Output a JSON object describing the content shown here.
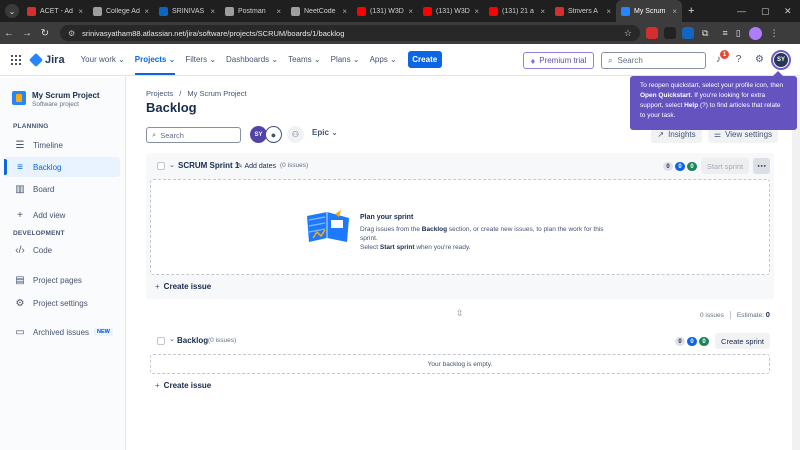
{
  "browser": {
    "tabs": [
      {
        "label": "ACET - Ad",
        "fav": "#d32f2f"
      },
      {
        "label": "College Ad",
        "fav": "#9e9e9e"
      },
      {
        "label": "SRINIVAS",
        "fav": "#0a66c2"
      },
      {
        "label": "Postman",
        "fav": "#9e9e9e"
      },
      {
        "label": "NeetCode",
        "fav": "#9e9e9e"
      },
      {
        "label": "(131) W3D",
        "fav": "#ff0000"
      },
      {
        "label": "(131) W3D",
        "fav": "#ff0000"
      },
      {
        "label": "(131) 21 a",
        "fav": "#ff0000"
      },
      {
        "label": "Strivers A",
        "fav": "#d32f2f"
      },
      {
        "label": "My Scrum",
        "fav": "#2684ff"
      }
    ],
    "url": "srinivasyatham88.atlassian.net/jira/software/projects/SCRUM/boards/1/backlog"
  },
  "topnav": {
    "product": "Jira",
    "menu": [
      "Your work",
      "Projects",
      "Filters",
      "Dashboards",
      "Teams",
      "Plans",
      "Apps"
    ],
    "create": "Create",
    "premium": "Premium trial",
    "search_placeholder": "Search",
    "notif_count": "1",
    "avatar_initials": "SY"
  },
  "sidebar": {
    "project_name": "My Scrum Project",
    "project_type": "Software project",
    "planning_header": "PLANNING",
    "timeline": "Timeline",
    "backlog": "Backlog",
    "board": "Board",
    "add_view": "Add view",
    "development_header": "DEVELOPMENT",
    "code": "Code",
    "project_pages": "Project pages",
    "project_settings": "Project settings",
    "archived_issues": "Archived issues",
    "new_badge": "NEW"
  },
  "main": {
    "breadcrumb_projects": "Projects",
    "breadcrumb_sep": "/",
    "breadcrumb_project": "My Scrum Project",
    "title": "Backlog",
    "search_placeholder": "Search",
    "avatar_initials": "SY",
    "epic": "Epic",
    "insights": "Insights",
    "view_settings": "View settings",
    "sprint": {
      "name": "SCRUM Sprint 1",
      "add_dates": "Add dates",
      "issue_count": "(0 issues)",
      "counts": [
        "0",
        "0",
        "0"
      ],
      "start": "Start sprint",
      "plan_heading": "Plan your sprint",
      "plan_line1_a": "Drag issues from the ",
      "plan_line1_b": "Backlog",
      "plan_line1_c": " section, or create new issues, to plan the work for this sprint.",
      "plan_line2_a": "Select ",
      "plan_line2_b": "Start sprint",
      "plan_line2_c": " when you're ready.",
      "create_issue": "Create issue"
    },
    "estimate": {
      "issues": "0 issues",
      "label": "Estimate:",
      "value": "0"
    },
    "backlog": {
      "name": "Backlog",
      "issue_count": "(0 issues)",
      "counts": [
        "0",
        "0",
        "0"
      ],
      "create_sprint": "Create sprint",
      "empty": "Your backlog is empty.",
      "create_issue": "Create issue"
    }
  },
  "tooltip": {
    "a": "To reopen quickstart, select your profile icon, then ",
    "b": "Open Quickstart",
    "c": ". If you're looking for extra support, select ",
    "d": "Help",
    "e": " (?) to find articles that relate to your task."
  }
}
